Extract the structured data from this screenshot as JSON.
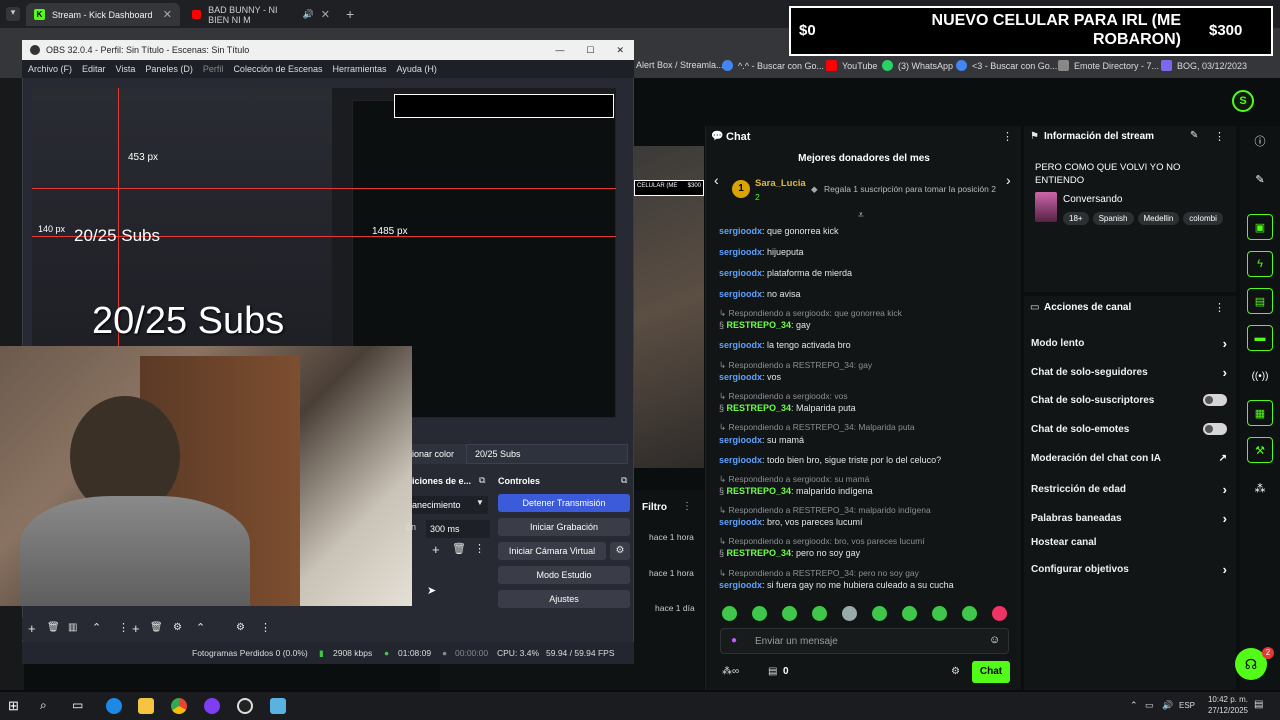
{
  "browser": {
    "tabs": [
      {
        "label": "Stream - Kick Dashboard",
        "active": true
      },
      {
        "label": "BAD BUNNY - NI BIEN NI M",
        "active": false
      }
    ],
    "bookmarks": [
      "Alert Box / Streamla...",
      "^.^ - Buscar con Go...",
      "YouTube",
      "(3) WhatsApp",
      "<3 - Buscar con Go...",
      "Emote Directory - 7...",
      "BOG, 03/12/2023"
    ]
  },
  "overlay": {
    "left_amount": "$0",
    "title": "NUEVO CELULAR PARA IRL (ME ROBARON)",
    "right_amount": "$300"
  },
  "obs": {
    "title": "OBS 32.0.4 - Perfil: Sin Título - Escenas: Sin Título",
    "menu": [
      "Archivo (F)",
      "Editar",
      "Vista",
      "Paneles (D)",
      "Perfil",
      "Colección de Escenas",
      "Herramientas",
      "Ayuda (H)"
    ],
    "preview_subs_label": "20/25 Subs",
    "preview_subs_small": "20/25 Subs",
    "preview_px_1": "453 px",
    "preview_px_2": "140 px",
    "preview_px_3": "1485 px",
    "source_color_label": "ionar color",
    "source_name": "20/25 Subs",
    "transitions_title": "iciones de e...",
    "transition_value": "anecimiento",
    "duration_label": "ón",
    "duration_value": "300 ms",
    "controls_title": "Controles",
    "controls": [
      "Detener Transmisión",
      "Iniciar Grabación",
      "Iniciar Cámara Virtual",
      "Modo Estudio",
      "Ajustes"
    ],
    "status": {
      "dropped": "Fotogramas Perdidos 0 (0.0%)",
      "kbps": "2908 kbps",
      "live_time": "01:08:09",
      "rec_time": "00:00:00",
      "cpu": "CPU: 3.4%",
      "fps": "59.94 / 59.94 FPS"
    }
  },
  "kick": {
    "filter_label": "Filtro",
    "times": [
      "hace 1 hora",
      "hace 1 hora",
      "hace 1 día"
    ],
    "video_overlay_title": "CELULAR (ME",
    "video_overlay_amount": "$300",
    "chat": {
      "title": "Chat",
      "donors_title": "Mejores donadores del mes",
      "donor_rank": "1",
      "donor_name": "Sara_Lucia",
      "donor_count": "2",
      "gift_text": "Regala 1 suscripción para tomar la posición 2",
      "messages": [
        {
          "type": "msg",
          "user": "sergioodx",
          "color": "blue",
          "text": ": que gonorrea kick"
        },
        {
          "type": "msg",
          "user": "sergioodx",
          "color": "blue",
          "text": ": hijueputa"
        },
        {
          "type": "msg",
          "user": "sergioodx",
          "color": "blue",
          "text": ": plataforma de mierda"
        },
        {
          "type": "msg",
          "user": "sergioodx",
          "color": "blue",
          "text": ": no avisa"
        },
        {
          "type": "reply",
          "text": "Respondiendo a sergioodx: que gonorrea kick"
        },
        {
          "type": "msg",
          "user": "RESTREPO_34",
          "color": "green",
          "text": ": gay"
        },
        {
          "type": "msg",
          "user": "sergioodx",
          "color": "blue",
          "text": ": la tengo activada bro"
        },
        {
          "type": "reply",
          "text": "Respondiendo a RESTREPO_34: gay"
        },
        {
          "type": "msg",
          "user": "sergioodx",
          "color": "blue",
          "text": ": vos"
        },
        {
          "type": "reply",
          "text": "Respondiendo a sergioodx: vos"
        },
        {
          "type": "msg",
          "user": "RESTREPO_34",
          "color": "green",
          "text": ": Malparida puta"
        },
        {
          "type": "reply",
          "text": "Respondiendo a RESTREPO_34: Malparida puta"
        },
        {
          "type": "msg",
          "user": "sergioodx",
          "color": "blue",
          "text": ": su mamá"
        },
        {
          "type": "msg",
          "user": "sergioodx",
          "color": "blue",
          "text": ": todo bien bro, sigue triste por lo del celuco?"
        },
        {
          "type": "reply",
          "text": "Respondiendo a sergioodx: su mamá"
        },
        {
          "type": "msg",
          "user": "RESTREPO_34",
          "color": "green",
          "text": ": malparido indígena"
        },
        {
          "type": "reply",
          "text": "Respondiendo a RESTREPO_34: malparido indígena"
        },
        {
          "type": "msg",
          "user": "sergioodx",
          "color": "blue",
          "text": ": bro, vos pareces lucumí"
        },
        {
          "type": "reply",
          "text": "Respondiendo a sergioodx: bro, vos pareces lucumí"
        },
        {
          "type": "msg",
          "user": "RESTREPO_34",
          "color": "green",
          "text": ": pero no soy gay"
        },
        {
          "type": "reply",
          "text": "Respondiendo a RESTREPO_34: pero no soy gay"
        },
        {
          "type": "msg",
          "user": "sergioodx",
          "color": "blue",
          "text": ": si fuera gay no me hubiera culeado a su cucha"
        }
      ],
      "input_placeholder": "Enviar un mensaje",
      "points": "0",
      "send_label": "Chat"
    },
    "info": {
      "title": "Información del stream",
      "stream_title": "PERO COMO QUE VOLVI YO NO ENTIENDO",
      "category": "Conversando",
      "tags": [
        "18+",
        "Spanish",
        "Medellin",
        "colombi"
      ]
    },
    "actions": {
      "title": "Acciones de canal",
      "items": [
        {
          "label": "Modo lento",
          "kind": "chevron"
        },
        {
          "label": "Chat de solo-seguidores",
          "kind": "chevron"
        },
        {
          "label": "Chat de solo-suscriptores",
          "kind": "toggle"
        },
        {
          "label": "Chat de solo-emotes",
          "kind": "toggle"
        },
        {
          "label": "Moderación del chat con IA",
          "kind": "external"
        },
        {
          "label": "Restricción de edad",
          "kind": "chevron"
        },
        {
          "label": "Palabras baneadas",
          "kind": "chevron"
        },
        {
          "label": "Hostear canal",
          "kind": "none"
        },
        {
          "label": "Configurar objetivos",
          "kind": "chevron"
        }
      ]
    },
    "help_badge": "2"
  },
  "taskbar": {
    "lang": "ESP",
    "time": "10:42 p. m.",
    "date": "27/12/2025"
  },
  "colors": {
    "kick_green": "#53fc18",
    "username_blue": "#5da1ff",
    "username_green": "#6dff47",
    "obs_blue": "#3b5bdb"
  }
}
